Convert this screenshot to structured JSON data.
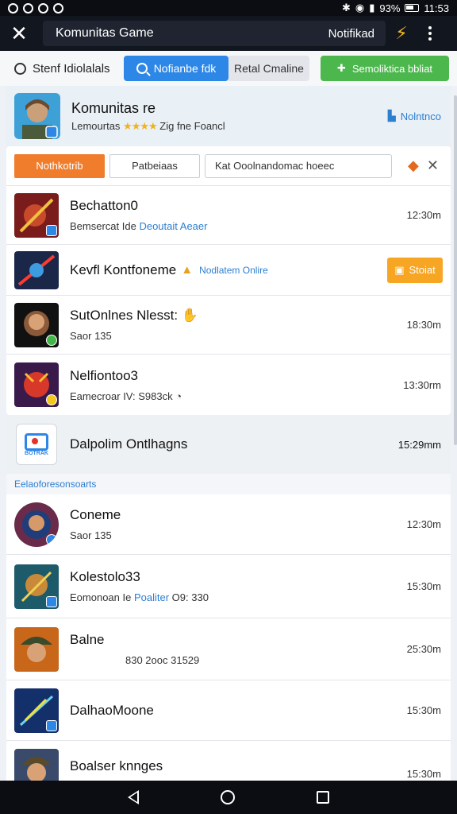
{
  "status_bar": {
    "battery": "93%",
    "time": "11:53"
  },
  "app_bar": {
    "title": "Komunitas Game",
    "notif_label": "Notifikad"
  },
  "filters": {
    "search_label": "Stenf Idiolalals",
    "blue_button": "Nofianbe fdk",
    "grey_button": "Retal Cmaline",
    "green_button": "Semoliktica bbliat"
  },
  "header": {
    "title": "Komunitas re",
    "subtitle_prefix": "Lemourtas",
    "stars": "★★★★",
    "subtitle_suffix": "Zig fne Foancl",
    "action": "Nolntnco"
  },
  "tabs": {
    "active": "Nothkotrib",
    "second": "Patbeiaas",
    "search": "Kat Ooolnandomac hoeec"
  },
  "rows": [
    {
      "name": "Bechatton0",
      "meta_prefix": "Bemsercat Ide",
      "meta_link": "Deoutait Aeaer",
      "time": "12:30m"
    },
    {
      "name": "Kevfl Kontfoneme",
      "link": "Nodlatem Onlire",
      "button": "Stoiat"
    },
    {
      "name": "SutOnlnes Nlesst:",
      "meta": "Saor 135",
      "time": "18:30m"
    },
    {
      "name": "Nelfiontoo3",
      "meta": "Eamecroar IV: S983ck",
      "time": "13:30rm"
    }
  ],
  "pinned": {
    "name": "Dalpolim Ontlhagns",
    "logo_text": "BOTRAK",
    "time": "15:29mm"
  },
  "section": {
    "title": "Eelaoforesonsoarts"
  },
  "section_rows": [
    {
      "name": "Coneme",
      "meta": "Saor 135",
      "time": "12:30m"
    },
    {
      "name": "Kolestolo33",
      "meta_prefix": "Eomonoan Ie",
      "meta_link": "Poaliter",
      "meta_suffix": "O9: 330",
      "time": "15:30m"
    },
    {
      "name": "Balne",
      "meta": "830 2ooc 31529",
      "time": "25:30m"
    },
    {
      "name": "DalhaoMoone",
      "time": "15:30m"
    },
    {
      "name": "Boalser knnges",
      "time": "15:30m"
    }
  ]
}
